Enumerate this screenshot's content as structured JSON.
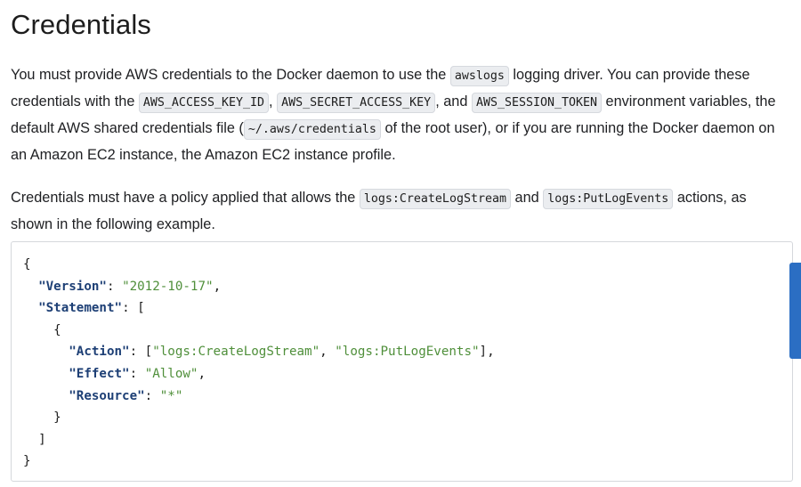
{
  "heading": "Credentials",
  "para1": {
    "t1": "You must provide AWS credentials to the Docker daemon to use the ",
    "c1": "awslogs",
    "t2": " logging driver. You can provide these credentials with the ",
    "c2": "AWS_ACCESS_KEY_ID",
    "t3": ", ",
    "c3": "AWS_SECRET_ACCESS_KEY",
    "t4": ", and ",
    "c4": "AWS_SESSION_TOKEN",
    "t5": " environment variables, the default AWS shared credentials file (",
    "c5": "~/.aws/credentials",
    "t6": " of the root user), or if you are running the Docker daemon on an Amazon EC2 instance, the Amazon EC2 instance profile."
  },
  "para2": {
    "t1": "Credentials must have a policy applied that allows the ",
    "c1": "logs:CreateLogStream",
    "t2": " and ",
    "c2": "logs:PutLogEvents",
    "t3": " actions, as shown in the following example."
  },
  "code": {
    "open_brace": "{",
    "version_key": "\"Version\"",
    "version_val": "\"2012-10-17\"",
    "statement_key": "\"Statement\"",
    "stmt_open": "{",
    "action_key": "\"Action\"",
    "action_val1": "\"logs:CreateLogStream\"",
    "action_val2": "\"logs:PutLogEvents\"",
    "effect_key": "\"Effect\"",
    "effect_val": "\"Allow\"",
    "resource_key": "\"Resource\"",
    "resource_val": "\"*\"",
    "stmt_close": "}",
    "array_close": "]",
    "close_brace": "}"
  },
  "colors": {
    "code_key": "#1d3f75",
    "code_string": "#4f8f3a",
    "scroll_thumb": "#2b6ec3",
    "inline_code_bg": "#ebedf0"
  }
}
